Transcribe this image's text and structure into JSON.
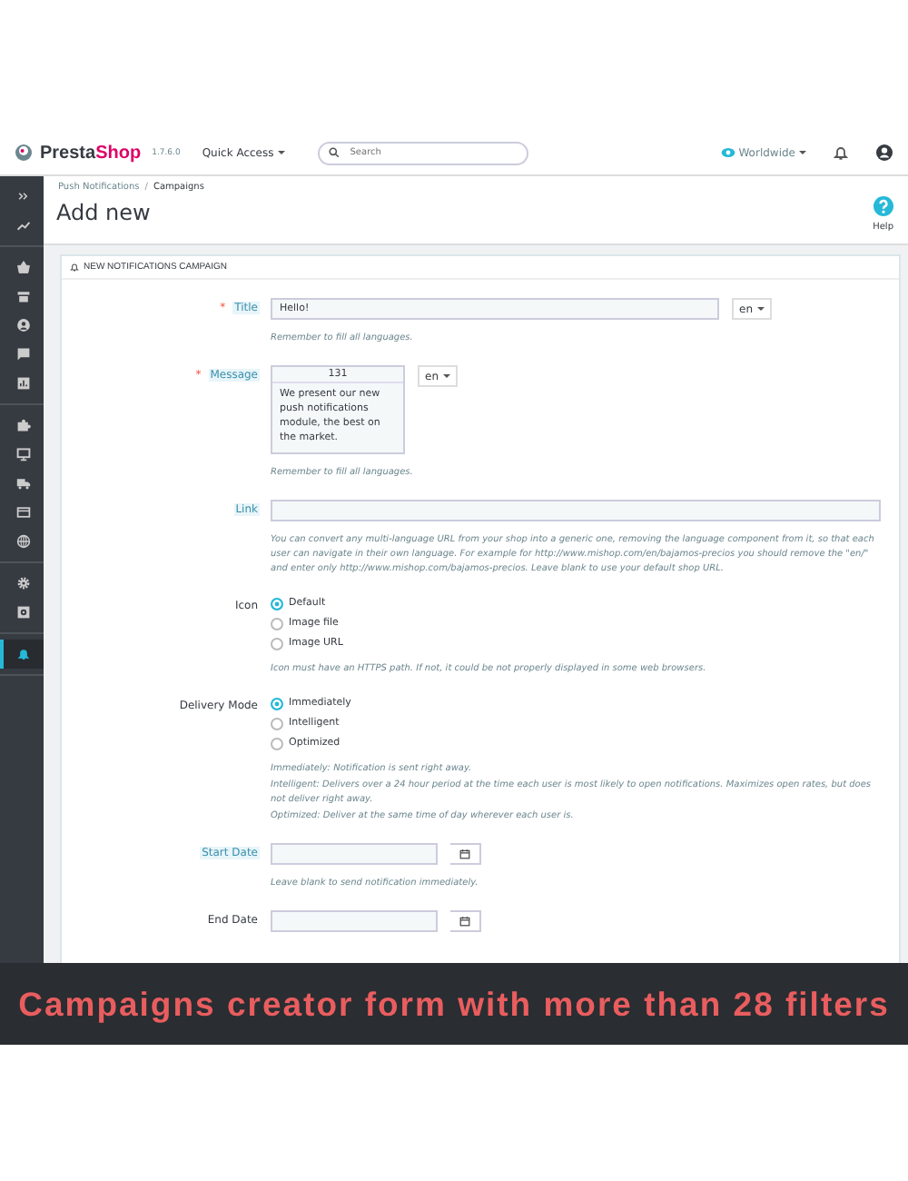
{
  "header": {
    "logo_start": "Presta",
    "logo_end": "Shop",
    "version": "1.7.6.0",
    "quick_access": "Quick Access",
    "search": {
      "placeholder": "Search"
    },
    "shop": "Worldwide"
  },
  "sidebar": {
    "groups": [
      {
        "items": [
          {
            "selected": false
          },
          {
            "selected": false
          }
        ]
      },
      {
        "items": [
          {
            "selected": false
          },
          {
            "selected": false
          },
          {
            "selected": false
          },
          {
            "selected": false
          },
          {
            "selected": false
          }
        ]
      },
      {
        "items": [
          {
            "selected": false
          },
          {
            "selected": false
          },
          {
            "selected": false
          },
          {
            "selected": false
          },
          {
            "selected": false
          }
        ]
      },
      {
        "items": [
          {
            "selected": false
          },
          {
            "selected": false
          }
        ]
      },
      {
        "items": [
          {
            "selected": true
          }
        ]
      }
    ]
  },
  "breadcrumb": {
    "separator": "/",
    "items": [
      "Push Notifications",
      "Campaigns"
    ]
  },
  "page_title": "Add new",
  "help": "Help",
  "panel": {
    "title": "NEW NOTIFICATIONS CAMPAIGN",
    "fields": [
      {
        "kind": "text",
        "label": "Title",
        "required_mark": "*",
        "has_help": true,
        "value": "Hello!",
        "lang": "en",
        "hints": [
          "Remember to fill all languages."
        ]
      },
      {
        "kind": "textarea",
        "label": "Message",
        "required_mark": "*",
        "has_help": true,
        "counter": "131",
        "value": "We present our new push notifications module, the best on the market.",
        "lang": "en",
        "hints": [
          "Remember to fill all languages."
        ]
      },
      {
        "kind": "text",
        "label": "Link",
        "has_help": true,
        "hints": [
          "You can convert any multi-language URL from your shop into a generic one, removing the language component from it, so that each user can navigate in their own language. For example for http://www.mishop.com/en/bajamos-precios you should remove the \"en/\" and enter only http://www.mishop.com/bajamos-precios. Leave blank to use your default shop URL."
        ]
      },
      {
        "kind": "radio",
        "label": "Icon",
        "has_help": false,
        "options": [
          {
            "label": "Default",
            "selected": true
          },
          {
            "label": "Image file",
            "selected": false
          },
          {
            "label": "Image URL",
            "selected": false
          }
        ],
        "hints": [
          "Icon must have an HTTPS path. If not, it could be not properly displayed in some web browsers."
        ]
      },
      {
        "kind": "radio",
        "label": "Delivery Mode",
        "has_help": false,
        "options": [
          {
            "label": "Immediately",
            "selected": true
          },
          {
            "label": "Intelligent",
            "selected": false
          },
          {
            "label": "Optimized",
            "selected": false
          }
        ],
        "hints": [
          "Immediately: Notification is sent right away.",
          "Intelligent: Delivers over a 24 hour period at the time each user is most likely to open notifications. Maximizes open rates, but does not deliver right away.",
          "Optimized: Deliver at the same time of day wherever each user is."
        ]
      },
      {
        "kind": "date",
        "label": "Start Date",
        "has_help": true,
        "hints": [
          "Leave blank to send notification immediately."
        ]
      },
      {
        "kind": "date",
        "label": "End Date",
        "has_help": false
      }
    ]
  },
  "caption": "Campaigns creator form with more than 28 filters"
}
